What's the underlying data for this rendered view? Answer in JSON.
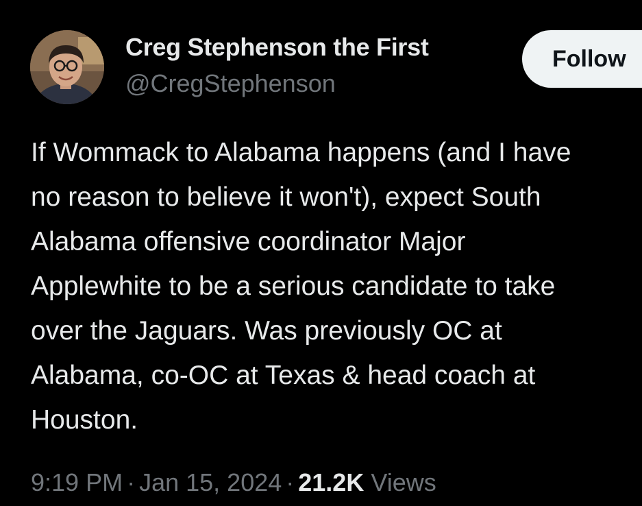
{
  "author": {
    "display_name": "Creg Stephenson the First",
    "handle": "@CregStephenson",
    "avatar_alt": "profile photo"
  },
  "actions": {
    "follow_label": "Follow"
  },
  "tweet": {
    "lines": [
      "If Wommack to Alabama happens (and I have",
      "no reason to believe it won't), expect South",
      "Alabama offensive coordinator Major",
      "Applewhite to be a serious candidate to take",
      "over the Jaguars. Was previously OC at",
      "Alabama, co-OC at Texas & head coach at",
      "Houston."
    ]
  },
  "meta": {
    "time": "9:19 PM",
    "separator": "·",
    "date": "Jan 15, 2024",
    "views_count": "21.2K",
    "views_label": "Views"
  },
  "colors": {
    "background": "#000000",
    "primary_text": "#e7e9ea",
    "secondary_text": "#71767b",
    "follow_bg": "#eff3f4",
    "follow_text": "#0f1419"
  }
}
